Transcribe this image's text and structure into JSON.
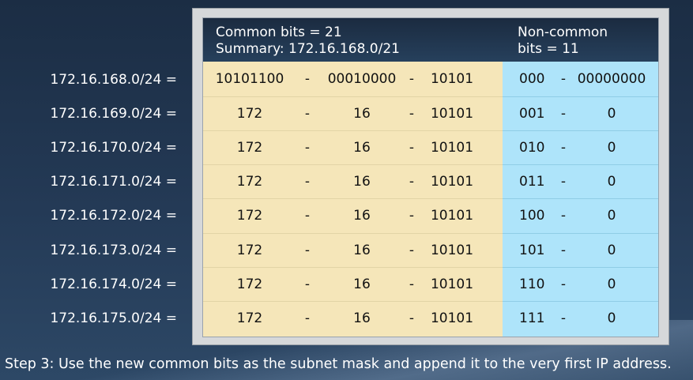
{
  "header": {
    "left_line1": "Common bits = 21",
    "left_line2": "Summary: 172.16.168.0/21",
    "right_line1": "Non-common",
    "right_line2": "bits = 11"
  },
  "rows": [
    {
      "label": "172.16.168.0/24 =",
      "o1": "10101100",
      "d1": "-",
      "o2": "00010000",
      "d2": "-",
      "o3": "10101",
      "nc": "000",
      "d3": "-",
      "o4": "00000000"
    },
    {
      "label": "172.16.169.0/24 =",
      "o1": "172",
      "d1": "-",
      "o2": "16",
      "d2": "-",
      "o3": "10101",
      "nc": "001",
      "d3": "-",
      "o4": "0"
    },
    {
      "label": "172.16.170.0/24 =",
      "o1": "172",
      "d1": "-",
      "o2": "16",
      "d2": "-",
      "o3": "10101",
      "nc": "010",
      "d3": "-",
      "o4": "0"
    },
    {
      "label": "172.16.171.0/24 =",
      "o1": "172",
      "d1": "-",
      "o2": "16",
      "d2": "-",
      "o3": "10101",
      "nc": "011",
      "d3": "-",
      "o4": "0"
    },
    {
      "label": "172.16.172.0/24 =",
      "o1": "172",
      "d1": "-",
      "o2": "16",
      "d2": "-",
      "o3": "10101",
      "nc": "100",
      "d3": "-",
      "o4": "0"
    },
    {
      "label": "172.16.173.0/24 =",
      "o1": "172",
      "d1": "-",
      "o2": "16",
      "d2": "-",
      "o3": "10101",
      "nc": "101",
      "d3": "-",
      "o4": "0"
    },
    {
      "label": "172.16.174.0/24 =",
      "o1": "172",
      "d1": "-",
      "o2": "16",
      "d2": "-",
      "o3": "10101",
      "nc": "110",
      "d3": "-",
      "o4": "0"
    },
    {
      "label": "172.16.175.0/24 =",
      "o1": "172",
      "d1": "-",
      "o2": "16",
      "d2": "-",
      "o3": "10101",
      "nc": "111",
      "d3": "-",
      "o4": "0"
    }
  ],
  "caption": "Step 3: Use the new common bits as the subnet mask and append it to the very first IP address.",
  "colors": {
    "common_bits_bg": "#f5e6b9",
    "noncommon_bits_bg": "#aee4fa",
    "header_bg": "#1f324a",
    "background": "#1b2d44"
  }
}
